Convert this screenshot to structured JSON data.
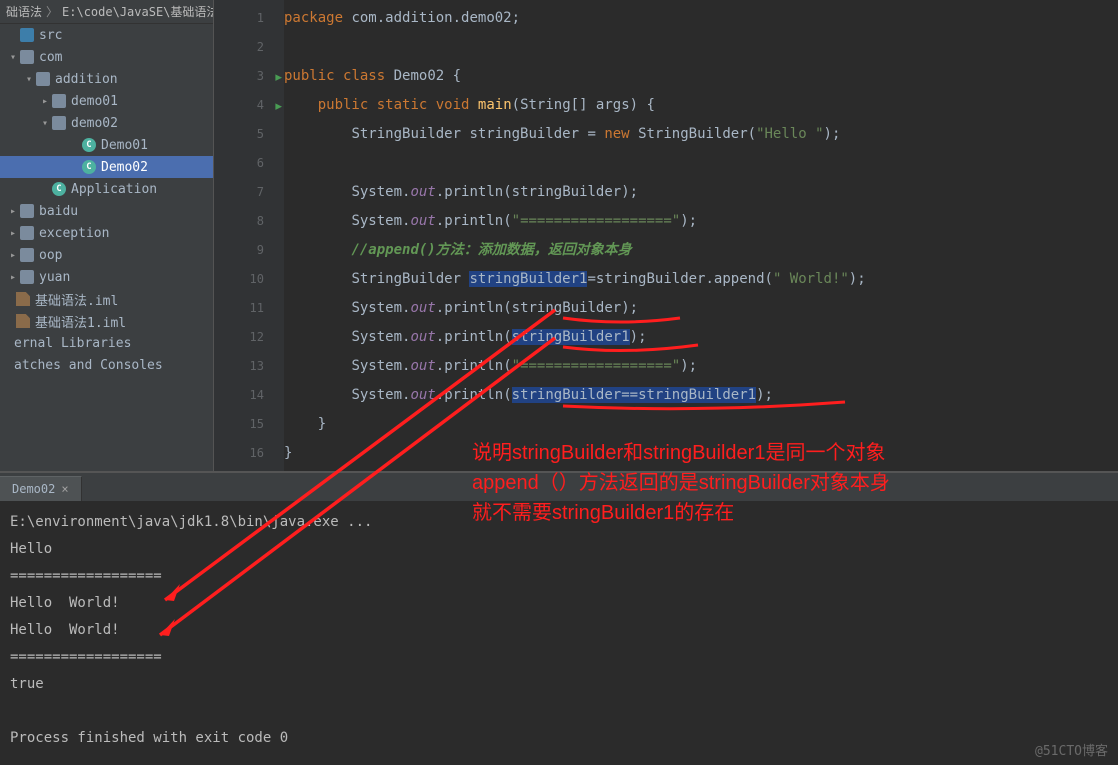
{
  "breadcrumb": {
    "part1": "础语法",
    "part2": "E:\\code\\JavaSE\\基础语法"
  },
  "tree": [
    {
      "pad": 6,
      "chev": "",
      "ico": "srcico",
      "label": "src"
    },
    {
      "pad": 6,
      "chev": "▾",
      "ico": "dirico",
      "label": "com"
    },
    {
      "pad": 22,
      "chev": "▾",
      "ico": "dirico",
      "label": "addition"
    },
    {
      "pad": 38,
      "chev": "▸",
      "ico": "dirico",
      "label": "demo01"
    },
    {
      "pad": 38,
      "chev": "▾",
      "ico": "dirico",
      "label": "demo02"
    },
    {
      "pad": 68,
      "chev": "",
      "ico": "clsico",
      "label": "Demo01"
    },
    {
      "pad": 68,
      "chev": "",
      "ico": "clsico",
      "label": "Demo02",
      "sel": true
    },
    {
      "pad": 38,
      "chev": "",
      "ico": "clsico",
      "label": "Application"
    },
    {
      "pad": 6,
      "chev": "▸",
      "ico": "dirico",
      "label": "baidu"
    },
    {
      "pad": 6,
      "chev": "▸",
      "ico": "dirico",
      "label": "exception"
    },
    {
      "pad": 6,
      "chev": "▸",
      "ico": "dirico",
      "label": "oop"
    },
    {
      "pad": 6,
      "chev": "▸",
      "ico": "dirico",
      "label": "yuan"
    },
    {
      "pad": 2,
      "chev": "",
      "ico": "filico",
      "label": "基础语法.iml"
    },
    {
      "pad": 2,
      "chev": "",
      "ico": "filico",
      "label": "基础语法1.iml"
    },
    {
      "pad": 0,
      "chev": "",
      "ico": "",
      "label": "ernal Libraries"
    },
    {
      "pad": 0,
      "chev": "",
      "ico": "",
      "label": "atches and Consoles"
    }
  ],
  "code": {
    "lines": [
      "1",
      "2",
      "3",
      "4",
      "5",
      "6",
      "7",
      "8",
      "9",
      "10",
      "11",
      "12",
      "13",
      "14",
      "15",
      "16"
    ],
    "runmarks": [
      3,
      4
    ],
    "tokens": {
      "kw_package": "package",
      "kw_public": "public",
      "kw_class": "class",
      "kw_static": "static",
      "kw_void": "void",
      "kw_new": "new",
      "pkg": "com.addition.demo02",
      "cls_demo": "Demo02",
      "fn_main": "main",
      "type_strarr": "String[] args",
      "type_sb": "StringBuilder",
      "var_sb": "stringBuilder",
      "var_sb1": "stringBuilder1",
      "sys": "System",
      "out": "out",
      "println": "println",
      "str_hello": "\"Hello \"",
      "str_divider": "\"==================\"",
      "str_world": "\" World!\"",
      "cmt_append": "//append()方法：添加数据，返回对象本身",
      "append": "append"
    }
  },
  "console": {
    "tab": "Demo02",
    "cmd": "E:\\environment\\java\\jdk1.8\\bin\\java.exe ...",
    "out": [
      "Hello ",
      "==================",
      "Hello  World!",
      "Hello  World!",
      "==================",
      "true",
      "",
      "Process finished with exit code 0"
    ]
  },
  "annotation": {
    "l1": "说明stringBuilder和stringBuilder1是同一个对象",
    "l2": "append（）方法返回的是stringBuilder对象本身",
    "l3": "就不需要stringBuilder1的存在"
  },
  "watermark": "@51CTO博客"
}
